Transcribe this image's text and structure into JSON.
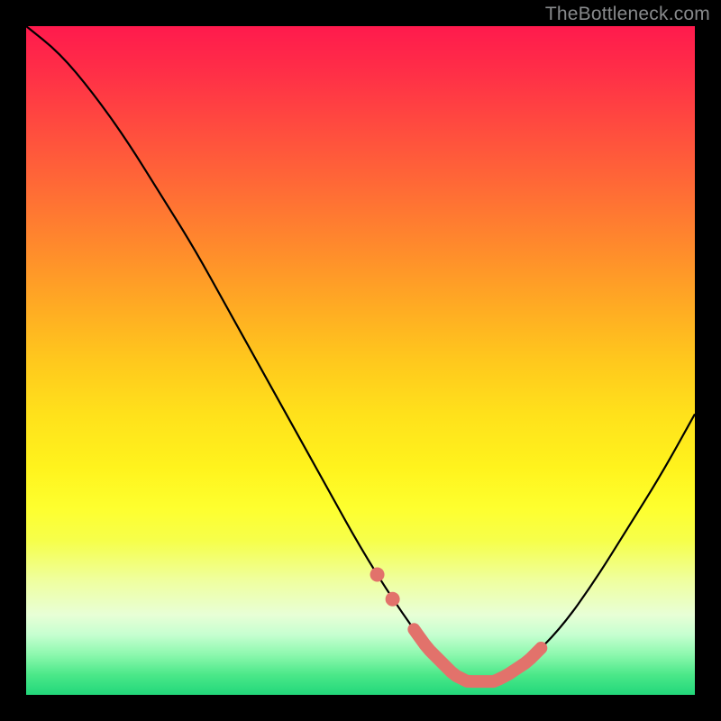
{
  "attribution": "TheBottleneck.com",
  "chart_data": {
    "type": "line",
    "title": "",
    "xlabel": "",
    "ylabel": "",
    "xlim": [
      0,
      100
    ],
    "ylim": [
      0,
      100
    ],
    "series": [
      {
        "name": "bottleneck-curve",
        "x": [
          0,
          5,
          10,
          15,
          20,
          25,
          30,
          35,
          40,
          45,
          50,
          55,
          60,
          62,
          64,
          66,
          68,
          70,
          72,
          75,
          80,
          85,
          90,
          95,
          100
        ],
        "y": [
          100,
          96,
          90,
          83,
          75,
          67,
          58,
          49,
          40,
          31,
          22,
          14,
          7,
          5,
          3,
          2,
          2,
          2,
          3,
          5,
          10,
          17,
          25,
          33,
          42
        ]
      }
    ],
    "highlight_range_x": [
      58,
      77
    ],
    "marker_dots_x": [
      52.5,
      54.8
    ]
  },
  "colors": {
    "curve": "#000000",
    "highlight": "#e2726b",
    "frame": "#000000"
  }
}
